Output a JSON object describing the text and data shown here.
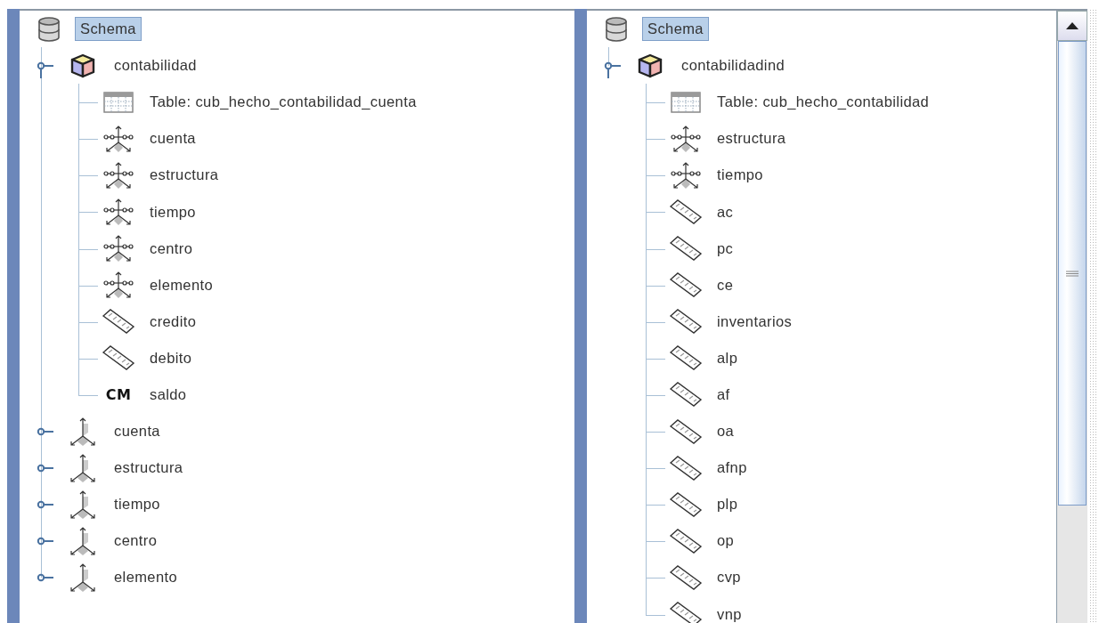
{
  "panels": [
    {
      "scrollbar": false,
      "tree": {
        "label": "Schema",
        "kind": "schema",
        "selected": true,
        "children": [
          {
            "label": "contabilidad",
            "kind": "cube",
            "selected": false,
            "expanded": true,
            "children": [
              {
                "label": "Table: cub_hecho_contabilidad_cuenta",
                "kind": "table",
                "selected": false
              },
              {
                "label": "cuenta",
                "kind": "dimension-usage",
                "selected": false
              },
              {
                "label": "estructura",
                "kind": "dimension-usage",
                "selected": false
              },
              {
                "label": "tiempo",
                "kind": "dimension-usage",
                "selected": false
              },
              {
                "label": "centro",
                "kind": "dimension-usage",
                "selected": false
              },
              {
                "label": "elemento",
                "kind": "dimension-usage",
                "selected": false
              },
              {
                "label": "credito",
                "kind": "measure",
                "selected": false
              },
              {
                "label": "debito",
                "kind": "measure",
                "selected": false
              },
              {
                "label": "saldo",
                "kind": "calc-member",
                "badge": "CM",
                "selected": false
              }
            ]
          },
          {
            "label": "cuenta",
            "kind": "dimension",
            "selected": false,
            "expanded": false
          },
          {
            "label": "estructura",
            "kind": "dimension",
            "selected": false,
            "expanded": false
          },
          {
            "label": "tiempo",
            "kind": "dimension",
            "selected": false,
            "expanded": false
          },
          {
            "label": "centro",
            "kind": "dimension",
            "selected": false,
            "expanded": false
          },
          {
            "label": "elemento",
            "kind": "dimension",
            "selected": false,
            "expanded": false
          }
        ]
      }
    },
    {
      "scrollbar": true,
      "tree": {
        "label": "Schema",
        "kind": "schema",
        "selected": true,
        "children": [
          {
            "label": "contabilidadind",
            "kind": "cube",
            "selected": false,
            "expanded": true,
            "children": [
              {
                "label": "Table: cub_hecho_contabilidad",
                "kind": "table",
                "selected": false
              },
              {
                "label": "estructura",
                "kind": "dimension-usage",
                "selected": false
              },
              {
                "label": "tiempo",
                "kind": "dimension-usage",
                "selected": false
              },
              {
                "label": "ac",
                "kind": "measure",
                "selected": false
              },
              {
                "label": "pc",
                "kind": "measure",
                "selected": false
              },
              {
                "label": "ce",
                "kind": "measure",
                "selected": false
              },
              {
                "label": "inventarios",
                "kind": "measure",
                "selected": false
              },
              {
                "label": "alp",
                "kind": "measure",
                "selected": false
              },
              {
                "label": "af",
                "kind": "measure",
                "selected": false
              },
              {
                "label": "oa",
                "kind": "measure",
                "selected": false
              },
              {
                "label": "afnp",
                "kind": "measure",
                "selected": false
              },
              {
                "label": "plp",
                "kind": "measure",
                "selected": false
              },
              {
                "label": "op",
                "kind": "measure",
                "selected": false
              },
              {
                "label": "cvp",
                "kind": "measure",
                "selected": false
              },
              {
                "label": "vnp",
                "kind": "measure",
                "selected": false
              }
            ]
          }
        ]
      }
    }
  ]
}
